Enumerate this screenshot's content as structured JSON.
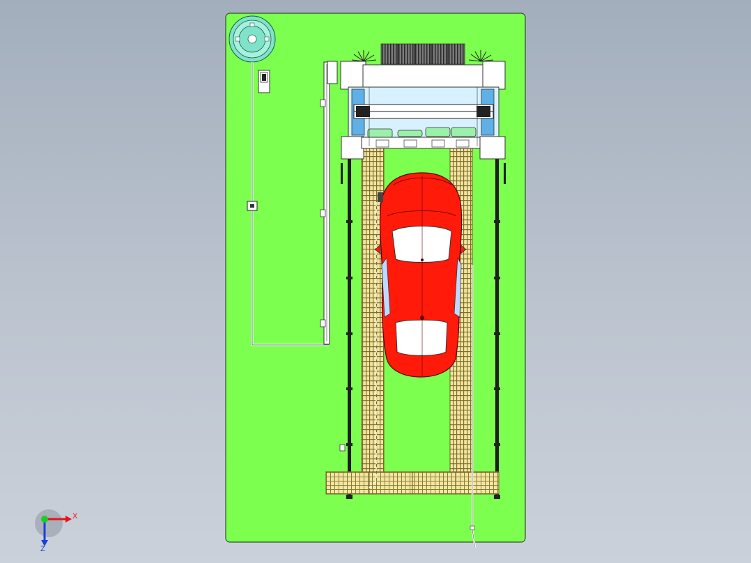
{
  "viewport": {
    "background_top": "#a3aebd",
    "background_bottom": "#cbd1da"
  },
  "model": {
    "name": "car-wash-gantry-top-view",
    "base_plate_color": "#7cff4f",
    "grating_color": "#f3e7a0",
    "car_body_color": "#ff1a0a",
    "car_glass_color": "#ffffff",
    "gantry_color": "#ffffff",
    "reel_color": "#7fe3c9",
    "brush_color": "#3a3a3a"
  },
  "triad": {
    "x_label": "X",
    "z_label": "Z",
    "x_color": "#e8131a",
    "z_color": "#1a3ed8",
    "y_color": "#1ecb25"
  }
}
